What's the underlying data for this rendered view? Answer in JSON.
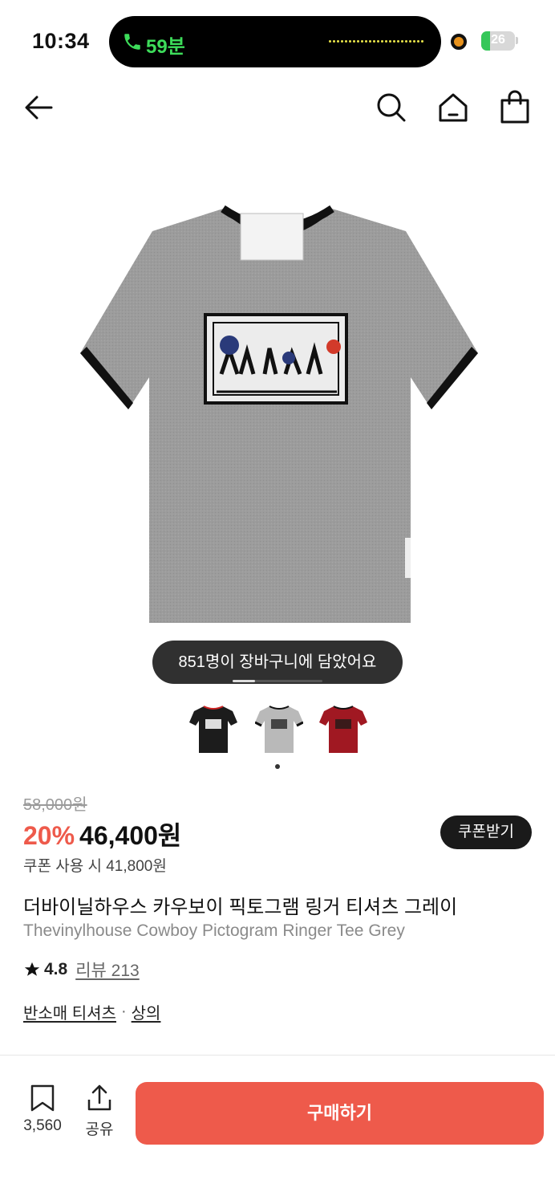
{
  "status_bar": {
    "time": "10:34",
    "call_label": "59분",
    "battery_level": "26",
    "battery_fraction": 0.26,
    "accent_green": "#3ddc5a"
  },
  "nav": {
    "icons": [
      "back-arrow-icon",
      "search-icon",
      "home-icon",
      "shopping-bag-icon"
    ]
  },
  "product": {
    "image_alt_colors": [
      "gray",
      "black",
      "red"
    ],
    "cart_toast": "851명이 장바구니에 담았어요",
    "gallery_progress": 0.25,
    "thumbnails": [
      {
        "color": "#1c1c1c",
        "name": "black"
      },
      {
        "color": "#b9b9b9",
        "name": "gray"
      },
      {
        "color": "#a01822",
        "name": "red"
      }
    ],
    "original_price": "58,000원",
    "discount_rate": "20%",
    "sale_price": "46,400원",
    "coupon_button": "쿠폰받기",
    "coupon_price_text": "쿠폰 사용 시 41,800원",
    "name_ko": "더바이닐하우스 카우보이 픽토그램 링거 티셔츠 그레이",
    "name_en": "Thevinylhouse Cowboy Pictogram Ringer Tee Grey",
    "rating": "4.8",
    "review_label": "리뷰 213",
    "category_1": "반소매 티셔츠",
    "category_separator": "·",
    "category_2": "상의"
  },
  "bottom_bar": {
    "bookmark_count": "3,560",
    "share_label": "공유",
    "buy_label": "구매하기"
  },
  "colors": {
    "accent_red": "#ee5a4b",
    "dark": "#1a1a1a"
  }
}
